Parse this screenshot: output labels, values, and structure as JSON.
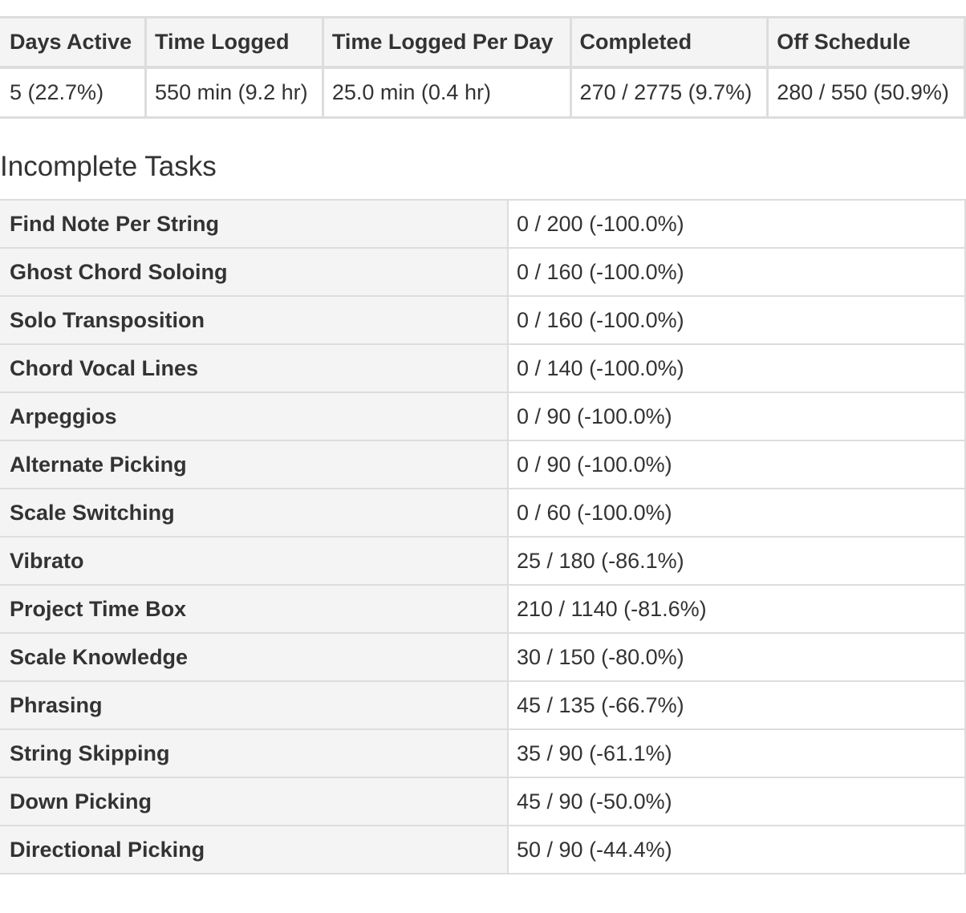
{
  "summary": {
    "headers": [
      "Days Active",
      "Time Logged",
      "Time Logged Per Day",
      "Completed",
      "Off Schedule"
    ],
    "values": [
      "5 (22.7%)",
      "550 min (9.2 hr)",
      "25.0 min (0.4 hr)",
      "270 / 2775 (9.7%)",
      "280 / 550 (50.9%)"
    ]
  },
  "incomplete": {
    "title": "Incomplete Tasks",
    "rows": [
      {
        "name": "Find Note Per String",
        "value": "0 / 200 (-100.0%)"
      },
      {
        "name": "Ghost Chord Soloing",
        "value": "0 / 160 (-100.0%)"
      },
      {
        "name": "Solo Transposition",
        "value": "0 / 160 (-100.0%)"
      },
      {
        "name": "Chord Vocal Lines",
        "value": "0 / 140 (-100.0%)"
      },
      {
        "name": "Arpeggios",
        "value": "0 / 90 (-100.0%)"
      },
      {
        "name": "Alternate Picking",
        "value": "0 / 90 (-100.0%)"
      },
      {
        "name": "Scale Switching",
        "value": "0 / 60 (-100.0%)"
      },
      {
        "name": "Vibrato",
        "value": "25 / 180 (-86.1%)"
      },
      {
        "name": "Project Time Box",
        "value": "210 / 1140 (-81.6%)"
      },
      {
        "name": "Scale Knowledge",
        "value": "30 / 150 (-80.0%)"
      },
      {
        "name": "Phrasing",
        "value": "45 / 135 (-66.7%)"
      },
      {
        "name": "String Skipping",
        "value": "35 / 90 (-61.1%)"
      },
      {
        "name": "Down Picking",
        "value": "45 / 90 (-50.0%)"
      },
      {
        "name": "Directional Picking",
        "value": "50 / 90 (-44.4%)"
      }
    ]
  }
}
